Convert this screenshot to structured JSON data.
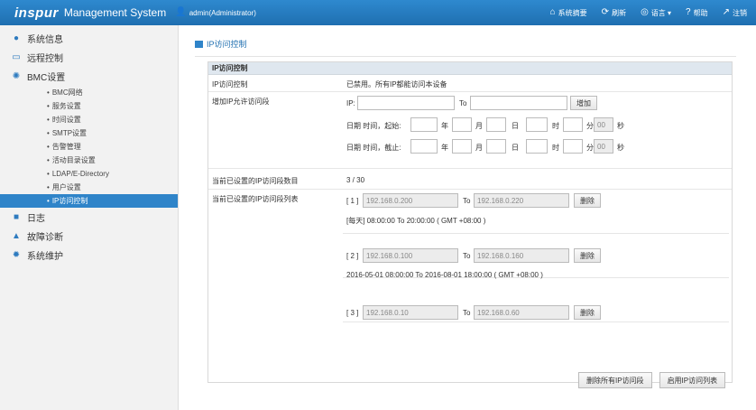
{
  "header": {
    "logo": "inspur",
    "system_name": "Management System",
    "user": "admin(Administrator)",
    "nav": [
      {
        "label": "系统摘要",
        "icon": "home-icon",
        "glyph": "⌂"
      },
      {
        "label": "刷新",
        "icon": "refresh-icon",
        "glyph": "⟳"
      },
      {
        "label": "语言 ▾",
        "icon": "globe-icon",
        "glyph": "◎"
      },
      {
        "label": "帮助",
        "icon": "help-icon",
        "glyph": "?"
      },
      {
        "label": "注销",
        "icon": "logout-icon",
        "glyph": "↗"
      }
    ]
  },
  "sidebar": {
    "items": [
      {
        "label": "系统信息",
        "icon": "info-icon",
        "glyph": "●"
      },
      {
        "label": "远程控制",
        "icon": "monitor-icon",
        "glyph": "▭"
      },
      {
        "label": "BMC设置",
        "icon": "gear-icon",
        "glyph": "✺"
      }
    ],
    "submenu": [
      "BMC网络",
      "服务设置",
      "时间设置",
      "SMTP设置",
      "告警管理",
      "活动目录设置",
      "LDAP/E-Directory",
      "用户设置",
      "IP访问控制"
    ],
    "bottom_items": [
      {
        "label": "日志",
        "icon": "log-icon",
        "glyph": "■"
      },
      {
        "label": "故障诊断",
        "icon": "warning-icon",
        "glyph": "▲"
      },
      {
        "label": "系统维护",
        "icon": "maintenance-icon",
        "glyph": "✹"
      }
    ]
  },
  "page": {
    "breadcrumb": "IP访问控制",
    "section_title": "IP访问控制",
    "rows": {
      "status_label": "IP访问控制",
      "status_value": "已禁用。所有IP都能访问本设备",
      "add_label": "增加IP允许访问段",
      "count_label": "当前已设置的IP访问段数目",
      "count_value": "3 / 30",
      "list_label": "当前已设置的IP访问段列表"
    },
    "add_form": {
      "ip_label": "IP:",
      "to_label": "To",
      "add_button": "增加",
      "start_label": "日期 时间，起始:",
      "end_label": "日期 时间，截止:",
      "year": "年",
      "month": "月",
      "day": "日",
      "hour": "时",
      "minute": "分",
      "second_value": "00",
      "second": "秒"
    },
    "ranges": [
      {
        "index": "[ 1 ]",
        "from": "192.168.0.200",
        "to": "192.168.0.220",
        "schedule": "[每天]  08:00:00  To    20:00:00  ( GMT +08:00 )"
      },
      {
        "index": "[ 2 ]",
        "from": "192.168.0.100",
        "to": "192.168.0.160",
        "schedule": "2016-05-01  08:00:00  To  2016-08-01  18:00:00  ( GMT +08:00 )"
      },
      {
        "index": "[ 3 ]",
        "from": "192.168.0.10",
        "to": "192.168.0.60",
        "schedule": ""
      }
    ],
    "to_text": "To",
    "delete_button": "删除",
    "delete_all_button": "删除所有IP访问段",
    "enable_button": "启用IP访问列表"
  }
}
